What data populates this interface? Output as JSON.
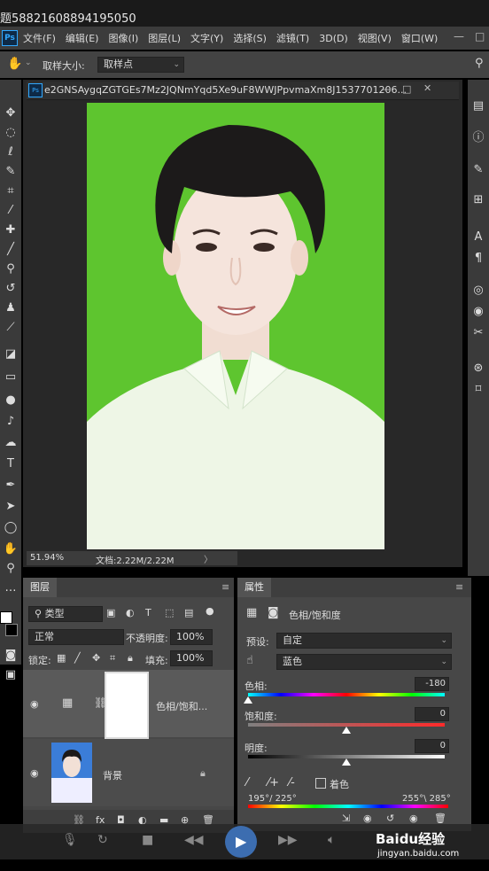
{
  "window": {
    "title_fragment": "题58821608894195050"
  },
  "menubar": {
    "app_icon": "Ps",
    "items": [
      "文件(F)",
      "编辑(E)",
      "图像(I)",
      "图层(L)",
      "文字(Y)",
      "选择(S)",
      "滤镜(T)",
      "3D(D)",
      "视图(V)",
      "窗口(W)"
    ]
  },
  "options": {
    "sample_size_label": "取样大小:",
    "sample_size_value": "取样点"
  },
  "document": {
    "tab_title": "e2GNSAygqZGTGEs7Mz2JQNmYqd5Xe9uF8WWJPpvmaXm8J1537701206...",
    "zoom": "51.94%",
    "doc_info": "文档:2.22M/2.22M",
    "canvas_bg": "#5ec52f"
  },
  "layers": {
    "tab_label": "图层",
    "filter_kind": "类型",
    "blend_mode": "正常",
    "opacity_label": "不透明度:",
    "opacity_value": "100%",
    "lock_label": "锁定:",
    "fill_label": "填充:",
    "fill_value": "100%",
    "rows": [
      {
        "name": "色相/饱和...",
        "visible": true
      },
      {
        "name": "背景",
        "visible": true
      }
    ]
  },
  "properties": {
    "tab_label": "属性",
    "adjustment_title": "色相/饱和度",
    "preset_label": "预设:",
    "preset_value": "自定",
    "channel_value": "蓝色",
    "hue_label": "色相:",
    "hue_value": "-180",
    "hue_pos": 0.0,
    "saturation_label": "饱和度:",
    "saturation_value": "0",
    "saturation_pos": 0.5,
    "lightness_label": "明度:",
    "lightness_value": "0",
    "lightness_pos": 0.5,
    "colorize_label": "着色",
    "range_left": "195°/ 225°",
    "range_right": "255°\\ 285°"
  },
  "watermark": {
    "text": "Baidu经验",
    "url": "jingyan.baidu.com"
  }
}
